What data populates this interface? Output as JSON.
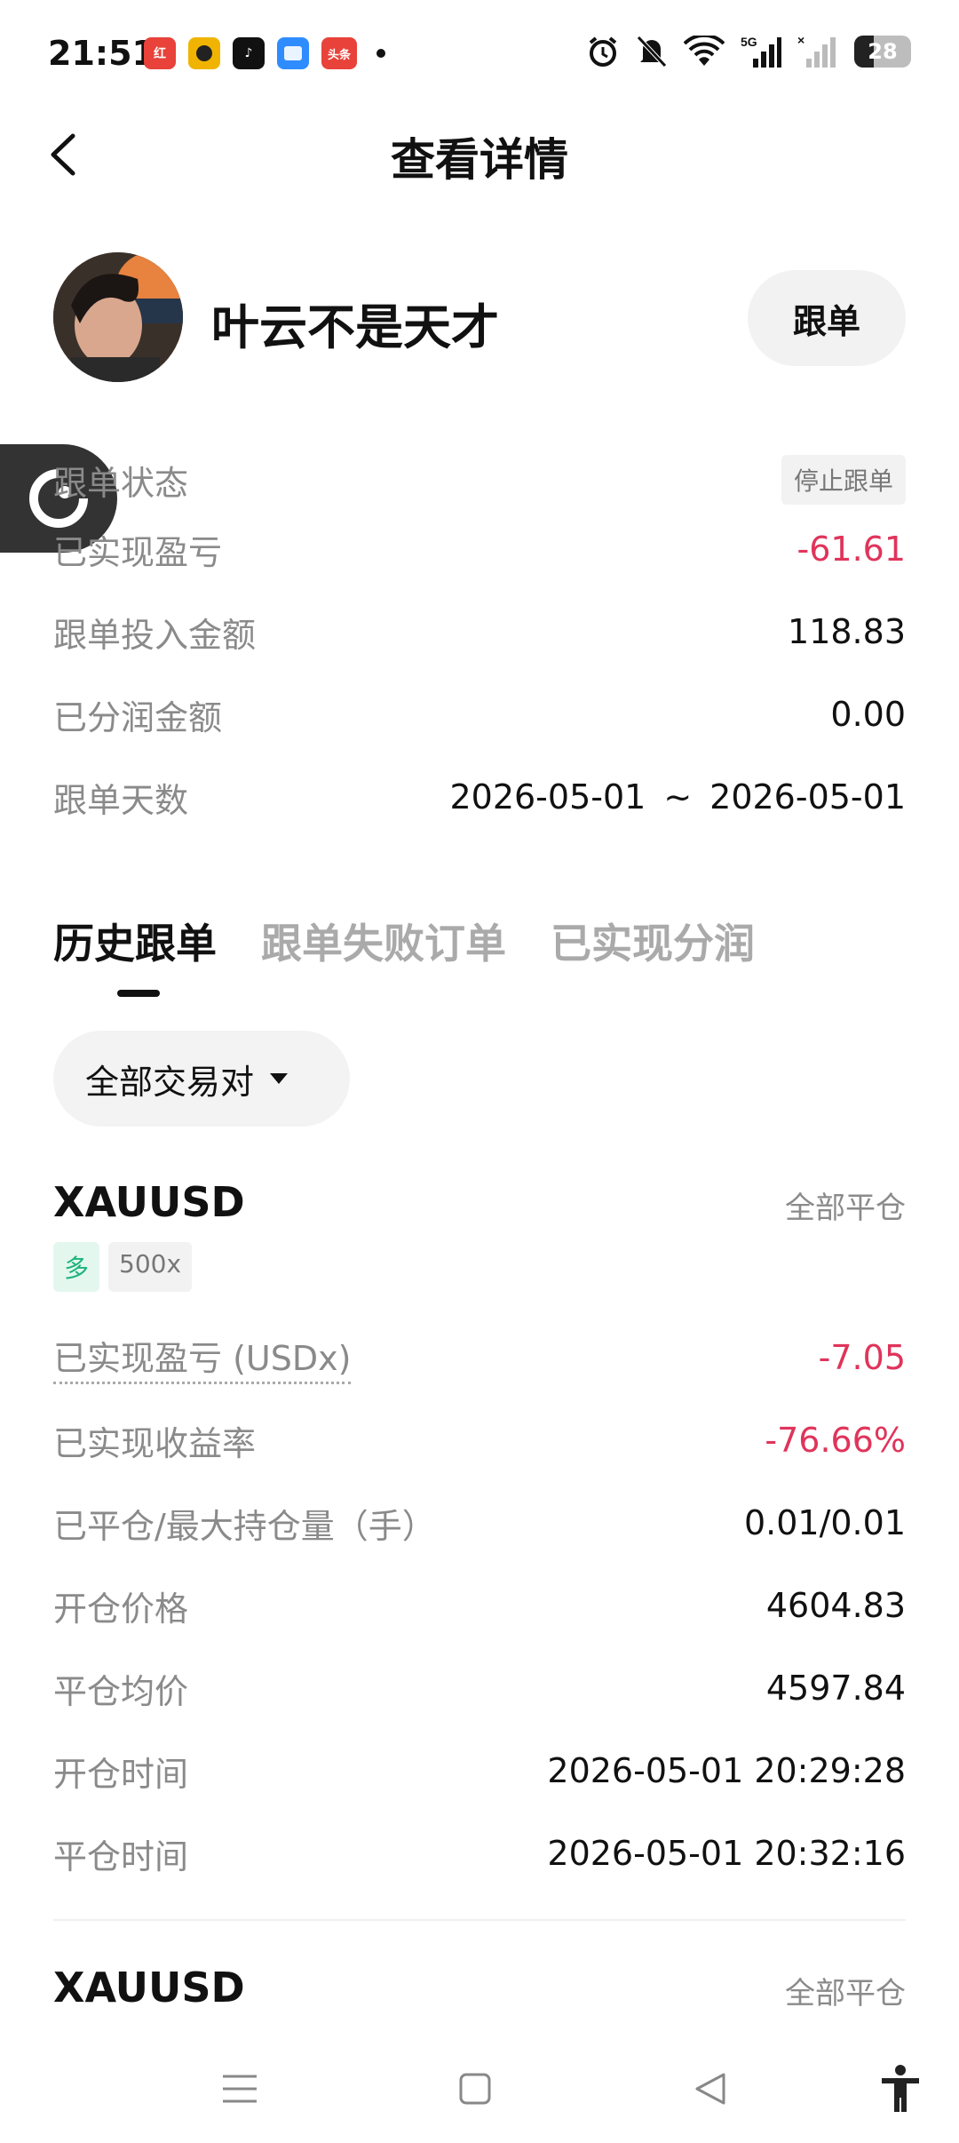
{
  "status_bar": {
    "time": "21:51",
    "apps": [
      {
        "name": "app-icon-1",
        "text": "红",
        "color": "#e8423a"
      },
      {
        "name": "app-icon-2",
        "text": "",
        "color": "#f0b400"
      },
      {
        "name": "tiktok-icon",
        "text": "♪",
        "color": "#111111"
      },
      {
        "name": "app-icon-4",
        "text": "",
        "color": "#2f8cff"
      },
      {
        "name": "toutiao-icon",
        "text": "头条",
        "color": "#e8423a"
      }
    ],
    "battery": "28",
    "network": "5G"
  },
  "header": {
    "title": "查看详情"
  },
  "profile": {
    "username": "叶云不是天才",
    "follow_label": "跟单"
  },
  "info": {
    "status_label": "跟单状态",
    "status_value": "停止跟单",
    "pnl_label": "已实现盈亏",
    "pnl_value": "-61.61",
    "invest_label": "跟单投入金额",
    "invest_value": "118.83",
    "share_label": "已分润金额",
    "share_value": "0.00",
    "days_label": "跟单天数",
    "days_start": "2026-05-01",
    "days_sep": "~",
    "days_end": "2026-05-01"
  },
  "tabs": [
    {
      "label": "历史跟单",
      "active": true
    },
    {
      "label": "跟单失败订单",
      "active": false
    },
    {
      "label": "已实现分润",
      "active": false
    }
  ],
  "filter": {
    "label": "全部交易对"
  },
  "trades": [
    {
      "symbol": "XAUUSD",
      "status": "全部平仓",
      "direction": "多",
      "leverage": "500x",
      "pnl_label": "已实现盈亏 (USDx)",
      "pnl_value": "-7.05",
      "roi_label": "已实现收益率",
      "roi_value": "-76.66%",
      "size_label": "已平仓/最大持仓量（手）",
      "size_value": "0.01/0.01",
      "open_price_label": "开仓价格",
      "open_price_value": "4604.83",
      "close_price_label": "平仓均价",
      "close_price_value": "4597.84",
      "open_time_label": "开仓时间",
      "open_time_value": "2026-05-01 20:29:28",
      "close_time_label": "平仓时间",
      "close_time_value": "2026-05-01 20:32:16"
    },
    {
      "symbol": "XAUUSD",
      "status": "全部平仓"
    }
  ],
  "colors": {
    "negative": "#e0345a",
    "long_tag": "#1bb37a",
    "muted": "#8a8a8a"
  }
}
